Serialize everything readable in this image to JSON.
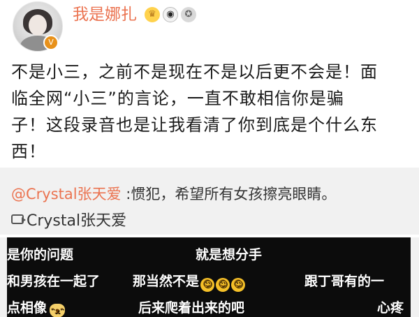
{
  "header": {
    "username": "我是娜扎",
    "avatar_badge_icon": "v-verified-icon",
    "badges": [
      "crown-icon",
      "panda-icon",
      "medal-icon"
    ]
  },
  "post": {
    "lines": [
      "不是小三，之前不是现在不是以后更不会是！面",
      "临全网“小三”的言论，一直不敢相信你是骗",
      "子！这段录音也是让我看清了你到底是个什么东",
      "西！"
    ]
  },
  "repost": {
    "mention": "@Crystal张天爱",
    "comment": " :惯犯，希望所有女孩擦亮眼睛。",
    "author": "Crystal张天爱",
    "author_icon": "repost-link-icon"
  },
  "video": {
    "captions": [
      "是你的问题",
      "就是想分手",
      "和男孩在一起了",
      "那当然不是",
      "跟丁哥有的一",
      "点相像",
      "后来爬着出来的吧",
      "心疼"
    ],
    "emoji_laugh": "😂",
    "emoji_cat": "🐱"
  }
}
